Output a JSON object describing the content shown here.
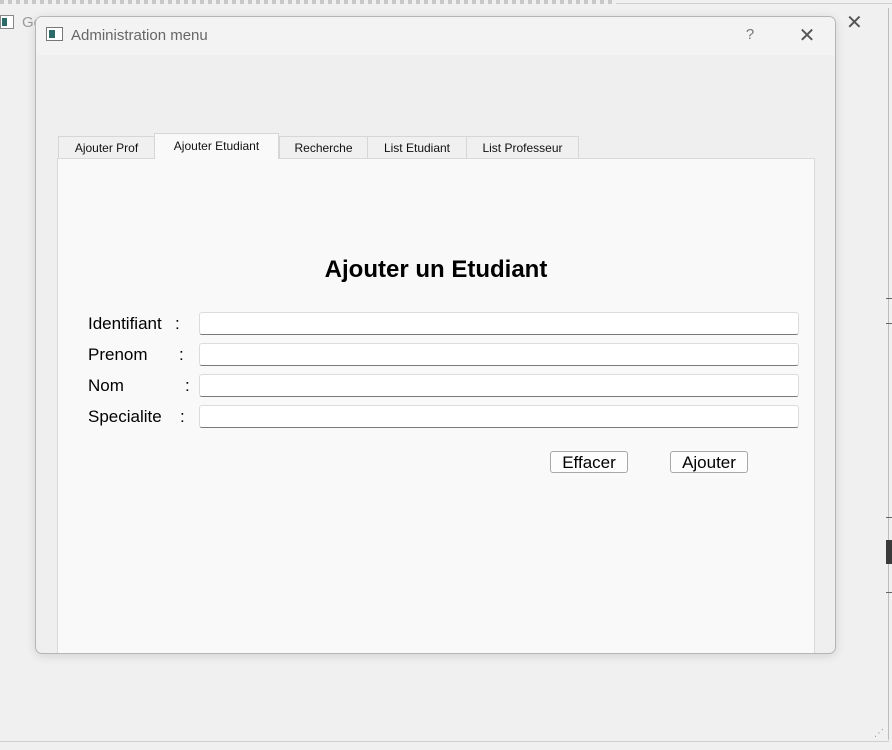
{
  "background_window": {
    "title": "Ge",
    "close_icon": "close-icon"
  },
  "dialog": {
    "title": "Administration menu",
    "help_label": "?",
    "close_label": "✕"
  },
  "tabs": [
    {
      "label": "Ajouter Prof",
      "active": false
    },
    {
      "label": "Ajouter Etudiant",
      "active": true
    },
    {
      "label": "Recherche",
      "active": false
    },
    {
      "label": "List Etudiant",
      "active": false
    },
    {
      "label": "List Professeur",
      "active": false
    }
  ],
  "form": {
    "title": "Ajouter un Etudiant",
    "fields": [
      {
        "label": "Identifiant",
        "value": ""
      },
      {
        "label": "Prenom",
        "value": ""
      },
      {
        "label": "Nom",
        "value": ""
      },
      {
        "label": "Specialite",
        "value": ""
      }
    ],
    "colon": ":",
    "clear_label": "Effacer",
    "add_label": "Ajouter"
  }
}
